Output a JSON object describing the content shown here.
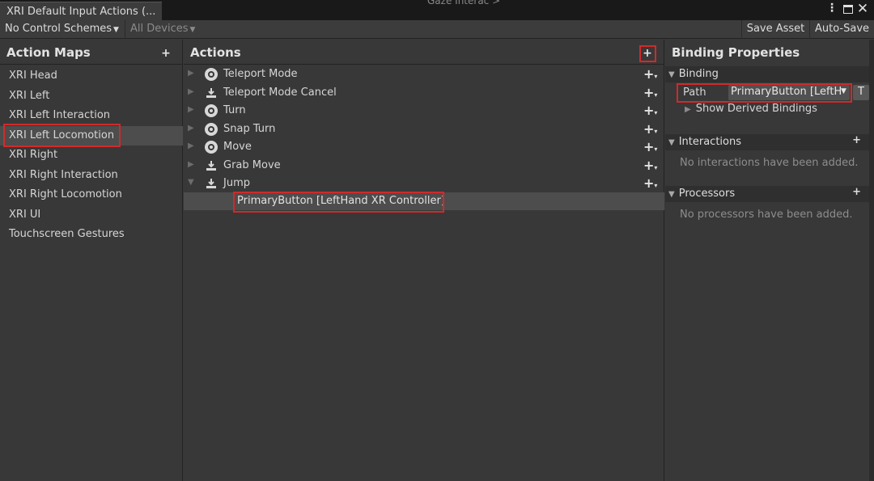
{
  "window": {
    "tab_title": "XRI Default Input Actions (...",
    "peek_text": "Gaze Interac >"
  },
  "toolbar": {
    "control_scheme": "No Control Schemes",
    "devices": "All Devices",
    "save_asset": "Save Asset",
    "auto_save": "Auto-Save"
  },
  "action_maps": {
    "header": "Action Maps",
    "add_label": "+",
    "items": [
      {
        "label": "XRI Head"
      },
      {
        "label": "XRI Left"
      },
      {
        "label": "XRI Left Interaction"
      },
      {
        "label": "XRI Left Locomotion"
      },
      {
        "label": "XRI Right"
      },
      {
        "label": "XRI Right Interaction"
      },
      {
        "label": "XRI Right Locomotion"
      },
      {
        "label": "XRI UI"
      },
      {
        "label": "Touchscreen Gestures"
      }
    ],
    "selected": "XRI Left Locomotion"
  },
  "actions": {
    "header": "Actions",
    "add_label": "+",
    "items": [
      {
        "label": "Teleport Mode",
        "icon": "value-action-icon"
      },
      {
        "label": "Teleport Mode Cancel",
        "icon": "button-action-icon"
      },
      {
        "label": "Turn",
        "icon": "value-action-icon"
      },
      {
        "label": "Snap Turn",
        "icon": "value-action-icon"
      },
      {
        "label": "Move",
        "icon": "value-action-icon"
      },
      {
        "label": "Grab Move",
        "icon": "button-action-icon"
      },
      {
        "label": "Jump",
        "icon": "button-action-icon"
      }
    ],
    "selected_binding": "PrimaryButton [LeftHand XR Controller]"
  },
  "binding_properties": {
    "header": "Binding Properties",
    "binding_section": "Binding",
    "path_label": "Path",
    "path_value": "PrimaryButton [LeftH",
    "t_button": "T",
    "show_derived": "Show Derived Bindings",
    "interactions_section": "Interactions",
    "interactions_empty": "No interactions have been added.",
    "processors_section": "Processors",
    "processors_empty": "No processors have been added.",
    "add_label": "+"
  }
}
